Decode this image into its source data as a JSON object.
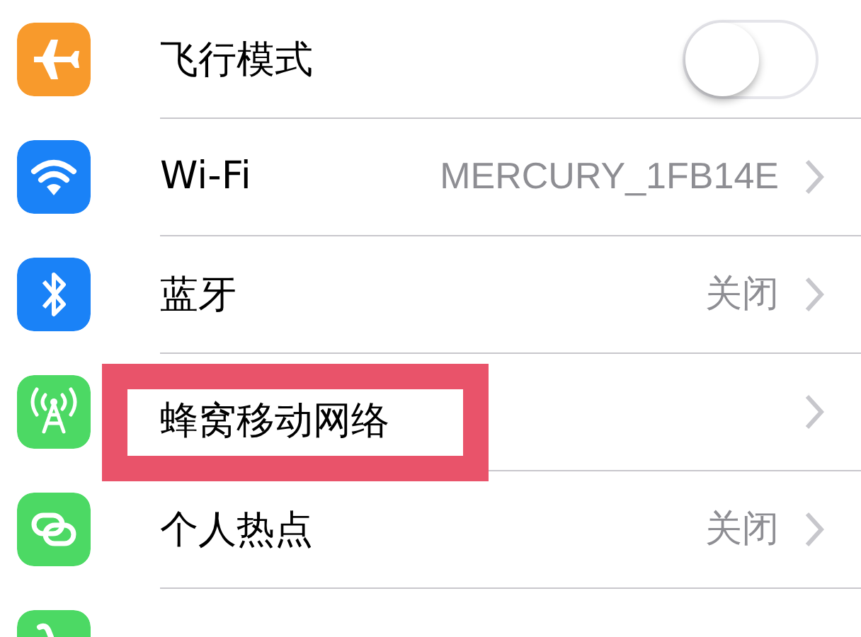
{
  "rows": [
    {
      "kind": "toggle",
      "color": "#f89a2c",
      "label": "飞行模式",
      "on": false
    },
    {
      "kind": "link",
      "color": "#1a82f7",
      "label": "Wi-Fi",
      "value": "MERCURY_1FB14E"
    },
    {
      "kind": "link",
      "color": "#1a82f7",
      "label": "蓝牙",
      "value": "关闭"
    },
    {
      "kind": "link",
      "color": "#4cd964",
      "label": "蜂窝移动网络",
      "highlighted": true
    },
    {
      "kind": "link",
      "color": "#4cd964",
      "label": "个人热点",
      "value": "关闭"
    },
    {
      "kind": "link",
      "color": "#4cd964"
    }
  ]
}
